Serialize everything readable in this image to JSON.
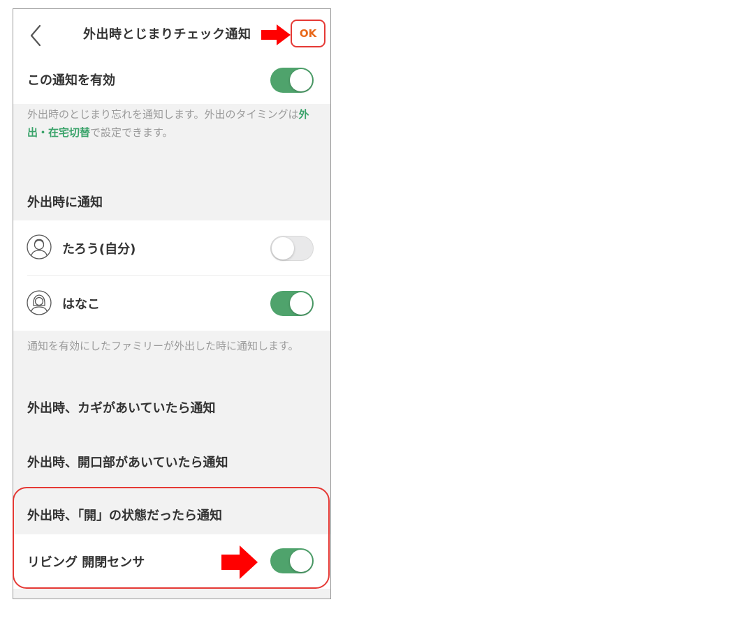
{
  "header": {
    "title": "外出時とじまりチェック通知",
    "ok_label": "OK"
  },
  "enable_row": {
    "label": "この通知を有効",
    "state": "on"
  },
  "description": {
    "prefix": "外出時のとじまり忘れを通知します。外出のタイミングは",
    "link": "外出・在宅切替",
    "suffix": "で設定できます。"
  },
  "notify_section": {
    "title": "外出時に通知",
    "members": [
      {
        "name": "たろう(自分)",
        "avatar_icon": "male-avatar-icon",
        "state": "off"
      },
      {
        "name": "はなこ",
        "avatar_icon": "female-avatar-icon",
        "state": "on"
      }
    ],
    "note": "通知を有効にしたファミリーが外出した時に通知します。"
  },
  "conditions": {
    "key_open": "外出時、カギがあいていたら通知",
    "opening_open": "外出時、開口部があいていたら通知",
    "status_open": "外出時、「開」の状態だったら通知"
  },
  "sensor_row": {
    "label": "リビング 開閉センサ",
    "state": "on"
  },
  "colors": {
    "toggle_on": "#4fa36c",
    "link": "#3aa36a",
    "ok_text": "#e8681a",
    "annotation_red": "#e53935",
    "arrow_red": "#ff0000"
  }
}
